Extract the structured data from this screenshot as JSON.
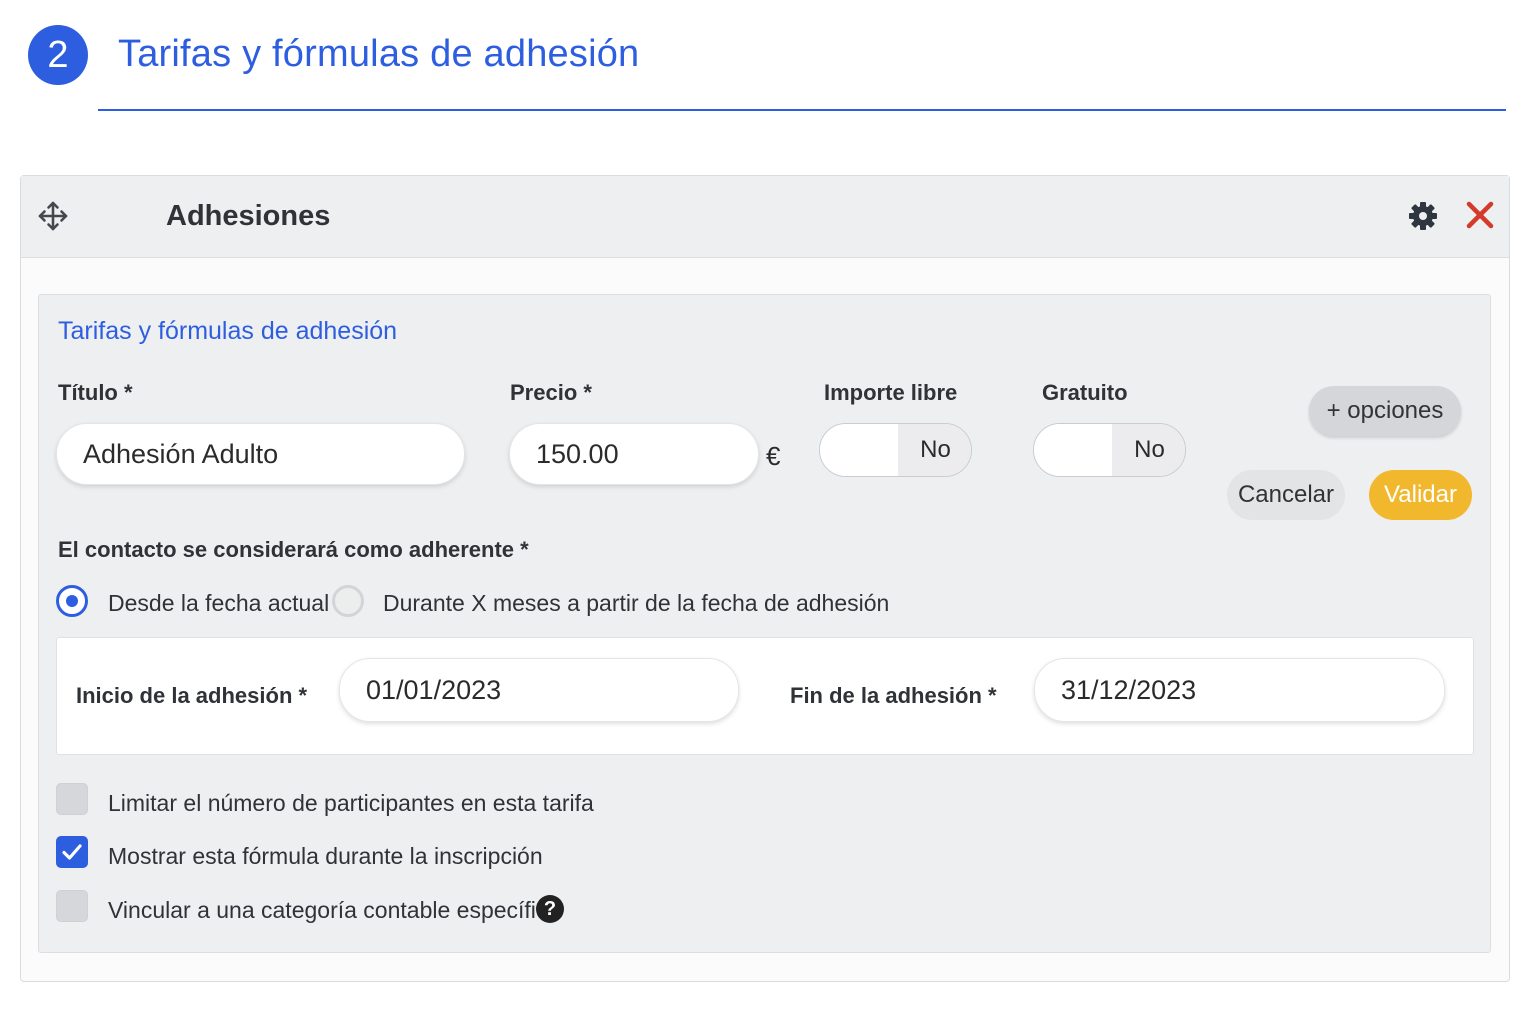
{
  "step": {
    "number": "2",
    "title": "Tarifas y fórmulas de adhesión"
  },
  "panel": {
    "title": "Adhesiones",
    "icons": {
      "move": "move-arrows-icon",
      "settings": "gear-icon",
      "close": "close-icon"
    },
    "close_color": "#d43a2a"
  },
  "card": {
    "title": "Tarifas y fórmulas de adhesión"
  },
  "form": {
    "title_label": "Título *",
    "title_value": "Adhesión Adulto",
    "price_label": "Precio *",
    "price_value": "150.00",
    "currency": "€",
    "free_amount_label": "Importe libre",
    "free_amount_value": "No",
    "free_label": "Gratuito",
    "free_value": "No"
  },
  "buttons": {
    "options": "+ opciones",
    "cancel": "Cancelar",
    "validate": "Validar"
  },
  "membership": {
    "question": "El contacto se considerará como adherente *",
    "options": [
      {
        "label": "Desde la fecha actual",
        "selected": true
      },
      {
        "label": "Durante X meses a partir de la fecha de adhesión",
        "selected": false
      }
    ],
    "start_label": "Inicio de la adhesión *",
    "start_value": "01/01/2023",
    "end_label": "Fin de la adhesión *",
    "end_value": "31/12/2023"
  },
  "checkboxes": [
    {
      "label": "Limitar el número de participantes en esta tarifa",
      "checked": false
    },
    {
      "label": "Mostrar esta fórmula durante la inscripción",
      "checked": true
    },
    {
      "label": "Vincular a una categoría contable específica",
      "checked": false,
      "help_icon": "question-circle-icon"
    }
  ],
  "colors": {
    "accent": "#2e5ee0",
    "validate": "#f1b82d",
    "close": "#d43a2a"
  }
}
